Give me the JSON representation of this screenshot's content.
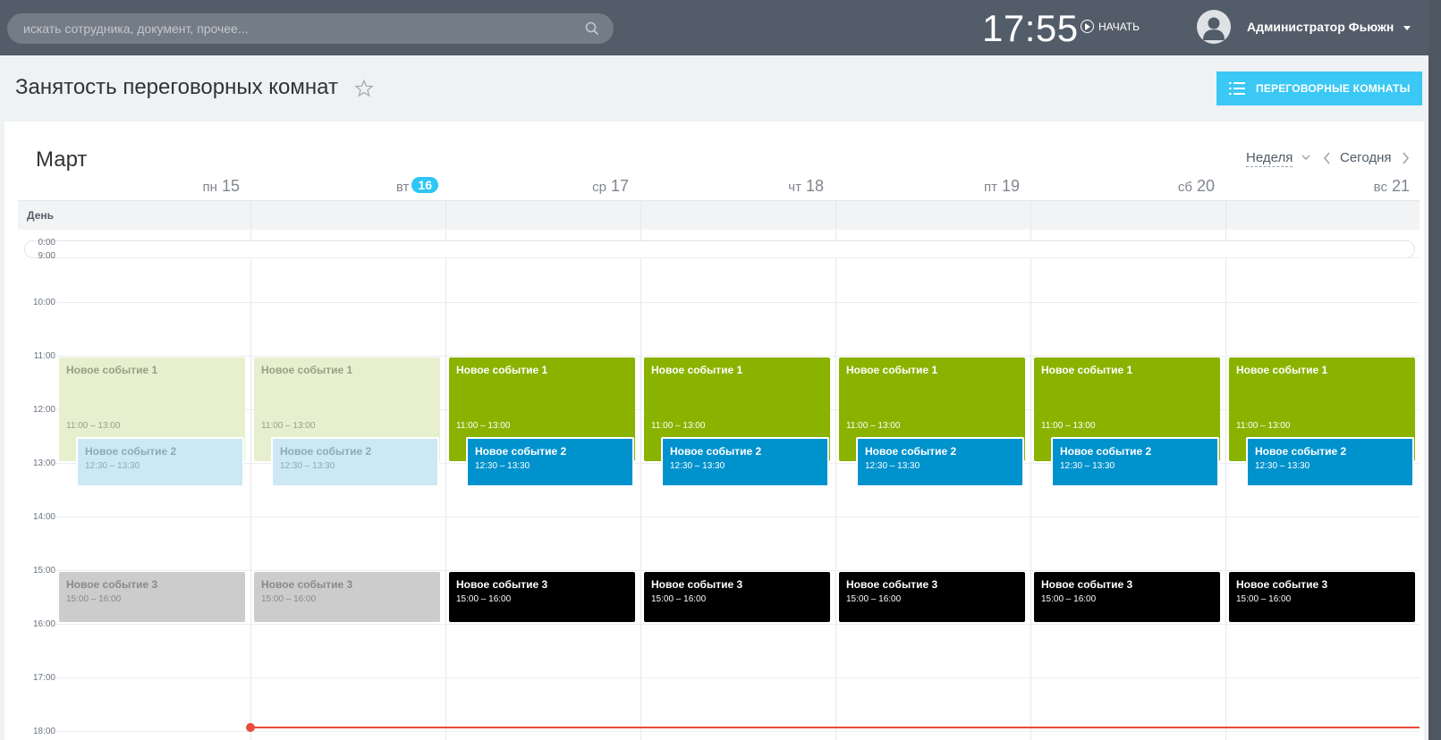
{
  "header": {
    "search_placeholder": "искать сотрудника, документ, прочее...",
    "clock": "17:55",
    "start_label": "НАЧАТЬ",
    "user_name": "Администратор Фьюжн"
  },
  "page": {
    "title": "Занятость переговорных комнат",
    "rooms_button": "ПЕРЕГОВОРНЫЕ КОМНАТЫ"
  },
  "calendar": {
    "month": "Март",
    "view": "Неделя",
    "today_label": "Сегодня",
    "allday_label": "День",
    "days": [
      {
        "dow": "пн",
        "num": "15"
      },
      {
        "dow": "вт",
        "num": "16"
      },
      {
        "dow": "ср",
        "num": "17"
      },
      {
        "dow": "чт",
        "num": "18"
      },
      {
        "dow": "пт",
        "num": "19"
      },
      {
        "dow": "сб",
        "num": "20"
      },
      {
        "dow": "вс",
        "num": "21"
      }
    ],
    "collapsed_hours": [
      "0:00",
      "9:00"
    ],
    "hours": [
      "10:00",
      "11:00",
      "12:00",
      "13:00",
      "14:00",
      "15:00",
      "16:00",
      "17:00",
      "18:00"
    ],
    "events": [
      {
        "title": "Новое событие 1",
        "time": "11:00 – 13:00"
      },
      {
        "title": "Новое событие 2",
        "time": "12:30 – 13:30"
      },
      {
        "title": "Новое событие 3",
        "time": "15:00 – 16:00"
      }
    ],
    "colors": {
      "green": "#8ab300",
      "blue": "#0092cd",
      "black": "#000000",
      "now_line": "#e74c3c",
      "today_badge": "#2fc6f6"
    }
  }
}
